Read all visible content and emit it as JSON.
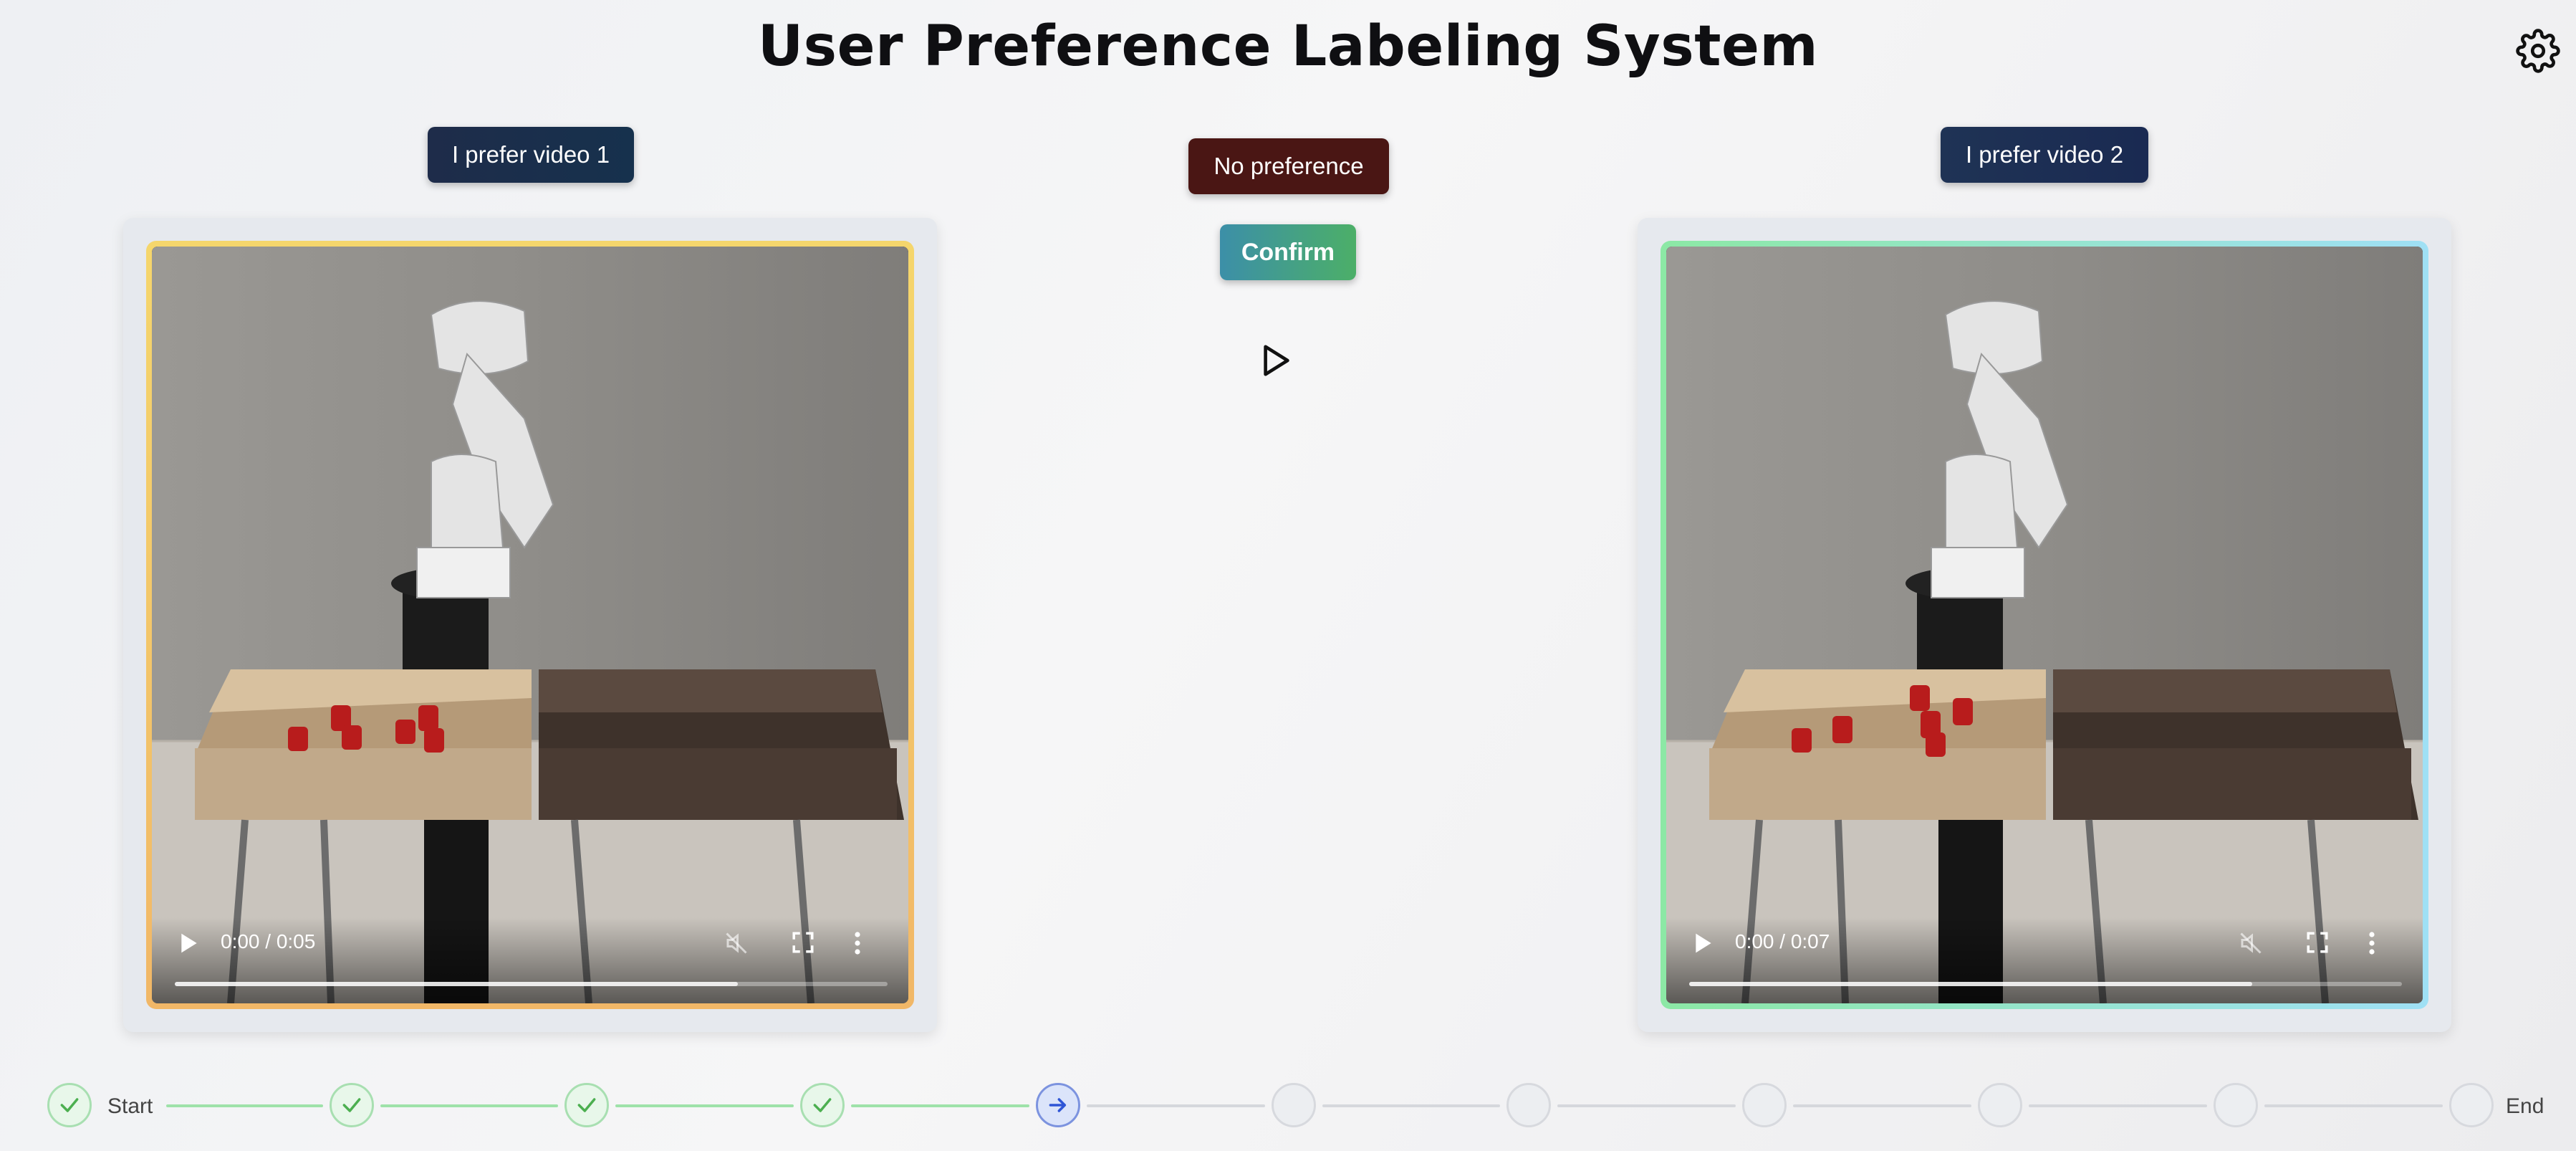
{
  "header": {
    "title": "User Preference Labeling System",
    "settings_icon": "gear-icon"
  },
  "actions": {
    "prefer_video_1": "I prefer video 1",
    "prefer_video_2": "I prefer video 2",
    "no_preference": "No preference",
    "confirm": "Confirm",
    "play_both_icon": "play-icon"
  },
  "video_1": {
    "time": "0:00 / 0:05",
    "progress_fraction": 0.79
  },
  "video_2": {
    "time": "0:00 / 0:07",
    "progress_fraction": 0.79
  },
  "stepper": {
    "start_label": "Start",
    "end_label": "End",
    "steps": [
      "done",
      "done",
      "done",
      "done",
      "current",
      "todo",
      "todo",
      "todo",
      "todo",
      "todo",
      "todo"
    ]
  },
  "colors": {
    "done": "#4caf50",
    "current": "#2e55d6",
    "no_preference_bg": "#4a1614"
  }
}
